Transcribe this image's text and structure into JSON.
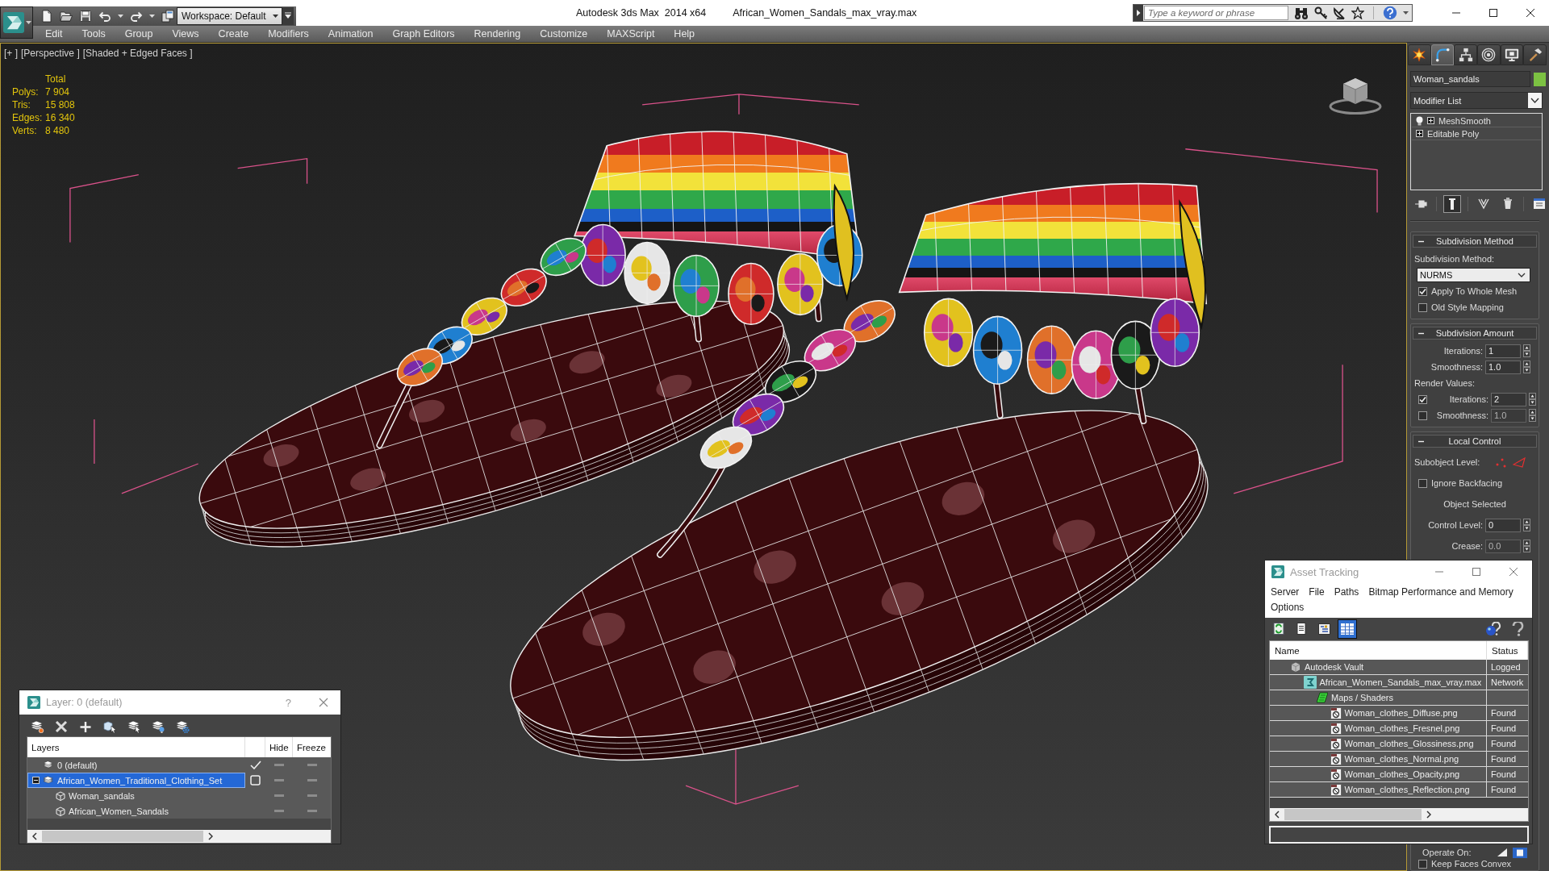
{
  "title_bar": {
    "workspace": "Workspace: Default",
    "app_title": "Autodesk 3ds Max  2014 x64",
    "file_name": "African_Women_Sandals_max_vray.max",
    "search": {
      "placeholder": "Type a keyword or phrase"
    }
  },
  "menu_bar": [
    "Edit",
    "Tools",
    "Group",
    "Views",
    "Create",
    "Modifiers",
    "Animation",
    "Graph Editors",
    "Rendering",
    "Customize",
    "MAXScript",
    "Help"
  ],
  "viewport": {
    "labels": [
      "[+ ]",
      "[Perspective ]",
      "[Shaded + Edged Faces ]"
    ],
    "stats": {
      "heading": "Total",
      "rows": [
        {
          "label": "Polys:",
          "value": "7 904"
        },
        {
          "label": "Tris:",
          "value": "15 808"
        },
        {
          "label": "Edges:",
          "value": "16 340"
        },
        {
          "label": "Verts:",
          "value": "8 480"
        }
      ]
    }
  },
  "command_panel": {
    "tabs": [
      {
        "kind": "create",
        "selected": false
      },
      {
        "kind": "modify",
        "selected": true
      },
      {
        "kind": "hierarchy",
        "selected": false
      },
      {
        "kind": "motion",
        "selected": false
      },
      {
        "kind": "display",
        "selected": false
      },
      {
        "kind": "utilities",
        "selected": false
      }
    ],
    "object_name": "Woman_sandals",
    "modifier_list": "Modifier List",
    "stack": [
      {
        "kind": "modifier",
        "name": "MeshSmooth",
        "expanded": false
      },
      {
        "kind": "base",
        "name": "Editable Poly",
        "expanded": false
      }
    ],
    "stack_tools": [
      {
        "kind": "pin",
        "on": false
      },
      {
        "kind": "end_result",
        "on": true
      },
      {
        "kind": "unique",
        "on": false
      },
      {
        "kind": "remove",
        "on": false
      },
      {
        "kind": "sets",
        "on": false
      }
    ],
    "rollouts": [
      {
        "title": "Subdivision Method",
        "expanded": true,
        "controls": [
          {
            "kind": "label",
            "text": "Subdivision Method:"
          },
          {
            "kind": "dropdown",
            "value": "NURMS"
          },
          {
            "kind": "checkbox",
            "label": "Apply To Whole Mesh",
            "checked": true
          },
          {
            "kind": "checkbox",
            "label": "Old Style Mapping",
            "checked": false
          }
        ]
      },
      {
        "title": "Subdivision Amount",
        "expanded": true,
        "controls": [
          {
            "kind": "spinner",
            "label": "Iterations:",
            "value": "1",
            "disabled": false
          },
          {
            "kind": "spinner",
            "label": "Smoothness:",
            "value": "1.0",
            "disabled": false
          },
          {
            "kind": "label",
            "text": "Render Values:"
          },
          {
            "kind": "check_spinner",
            "label": "Iterations:",
            "value": "2",
            "checked": true,
            "disabled": false
          },
          {
            "kind": "check_spinner",
            "label": "Smoothness:",
            "value": "1.0",
            "checked": false,
            "disabled": true
          }
        ]
      },
      {
        "title": "Local Control",
        "expanded": true,
        "controls": [
          {
            "kind": "subobject",
            "label": "Subobject Level:"
          },
          {
            "kind": "checkbox",
            "label": "Ignore Backfacing",
            "checked": false
          },
          {
            "kind": "status",
            "text": "Object Selected"
          },
          {
            "kind": "spinner",
            "label": "Control Level:",
            "value": "0",
            "disabled": false
          },
          {
            "kind": "spinner",
            "label": "Crease:",
            "value": "0.0",
            "disabled": true
          }
        ],
        "footer": [
          {
            "kind": "operate",
            "label": "Operate On:"
          },
          {
            "kind": "checkbox",
            "label": "Keep Faces Convex",
            "checked": false
          }
        ]
      }
    ]
  },
  "layer_dialog": {
    "title": "Layer: 0 (default)",
    "help": "?",
    "columns": [
      "Layers",
      "Hide",
      "Freeze"
    ],
    "layers": [
      {
        "kind": "layer",
        "name": "0 (default)",
        "current": true,
        "selected": false,
        "hidden": false,
        "frozen": false
      },
      {
        "kind": "layer",
        "name": "African_Women_Traditional_Clothing_Set",
        "current": false,
        "selected": true,
        "hidden": false,
        "frozen": false,
        "expanded": true,
        "children": [
          {
            "kind": "object",
            "name": "Woman_sandals",
            "selected": false,
            "hidden": false,
            "frozen": false
          },
          {
            "kind": "object",
            "name": "African_Women_Sandals",
            "selected": false,
            "hidden": false,
            "frozen": false
          }
        ]
      }
    ]
  },
  "asset_tracking": {
    "title": "Asset Tracking",
    "menu": [
      "Server",
      "File",
      "Paths",
      "Bitmap Performance and Memory",
      "Options"
    ],
    "toolbar": [
      {
        "kind": "refresh",
        "selected": false
      },
      {
        "kind": "list",
        "selected": false
      },
      {
        "kind": "tree",
        "selected": false
      },
      {
        "kind": "table",
        "selected": true
      }
    ],
    "columns": [
      "Name",
      "Status"
    ],
    "assets": [
      {
        "kind": "vault",
        "name": "Autodesk Vault",
        "status": "Logged",
        "selected": false,
        "children": [
          {
            "kind": "scene",
            "name": "African_Women_Sandals_max_vray.max",
            "status": "Network",
            "selected": false,
            "children": [
              {
                "kind": "folder",
                "name": "Maps / Shaders",
                "selected": false,
                "children": [
                  {
                    "kind": "bitmap",
                    "name": "Woman_clothes_Diffuse.png",
                    "status": "Found",
                    "selected": false
                  },
                  {
                    "kind": "bitmap",
                    "name": "Woman_clothes_Fresnel.png",
                    "status": "Found",
                    "selected": false
                  },
                  {
                    "kind": "bitmap",
                    "name": "Woman_clothes_Glossiness.png",
                    "status": "Found",
                    "selected": false
                  },
                  {
                    "kind": "bitmap",
                    "name": "Woman_clothes_Normal.png",
                    "status": "Found",
                    "selected": false
                  },
                  {
                    "kind": "bitmap",
                    "name": "Woman_clothes_Opacity.png",
                    "status": "Found",
                    "selected": false
                  },
                  {
                    "kind": "bitmap",
                    "name": "Woman_clothes_Reflection.png",
                    "status": "Found",
                    "selected": false
                  }
                ]
              }
            ]
          }
        ]
      }
    ]
  }
}
